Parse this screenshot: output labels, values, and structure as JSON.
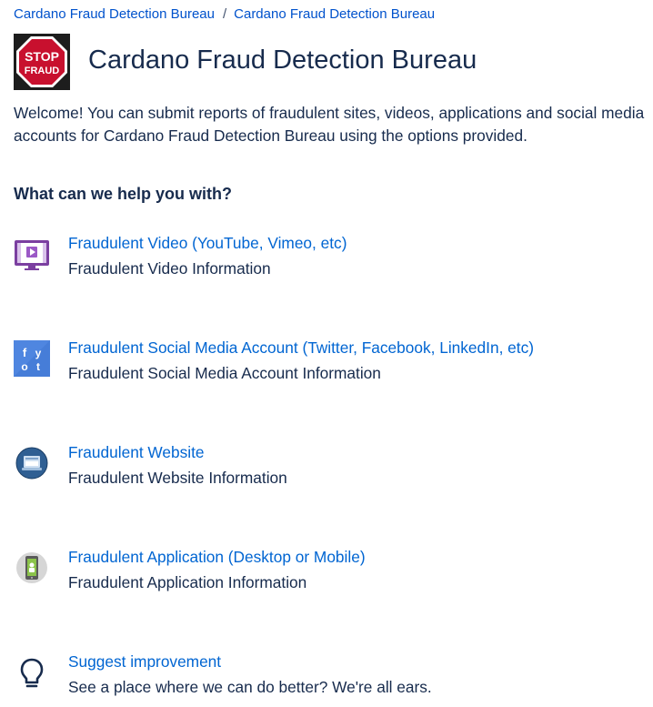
{
  "breadcrumb": {
    "items": [
      "Cardano Fraud Detection Bureau",
      "Cardano Fraud Detection Bureau"
    ],
    "separator": "/"
  },
  "logo": {
    "line1": "STOP",
    "line2": "FRAUD"
  },
  "header": {
    "title": "Cardano Fraud Detection Bureau"
  },
  "intro": {
    "text": "Welcome! You can submit reports of fraudulent sites, videos, applications and social media accounts for Cardano Fraud Detection Bureau using the options provided."
  },
  "help": {
    "heading": "What can we help you with?"
  },
  "options": [
    {
      "icon": "video-icon",
      "title": "Fraudulent Video (YouTube, Vimeo, etc)",
      "description": "Fraudulent Video Information"
    },
    {
      "icon": "social-media-icon",
      "title": "Fraudulent Social Media Account (Twitter, Facebook, LinkedIn, etc)",
      "description": "Fraudulent Social Media Account Information"
    },
    {
      "icon": "website-icon",
      "title": "Fraudulent Website",
      "description": "Fraudulent Website Information"
    },
    {
      "icon": "application-icon",
      "title": "Fraudulent Application (Desktop or Mobile)",
      "description": "Fraudulent Application Information"
    },
    {
      "icon": "lightbulb-icon",
      "title": "Suggest improvement",
      "description": "See a place where we can do better? We're all ears."
    }
  ],
  "colors": {
    "link": "#0065d2",
    "text": "#172b4d",
    "stop_sign": "#c8102e"
  }
}
